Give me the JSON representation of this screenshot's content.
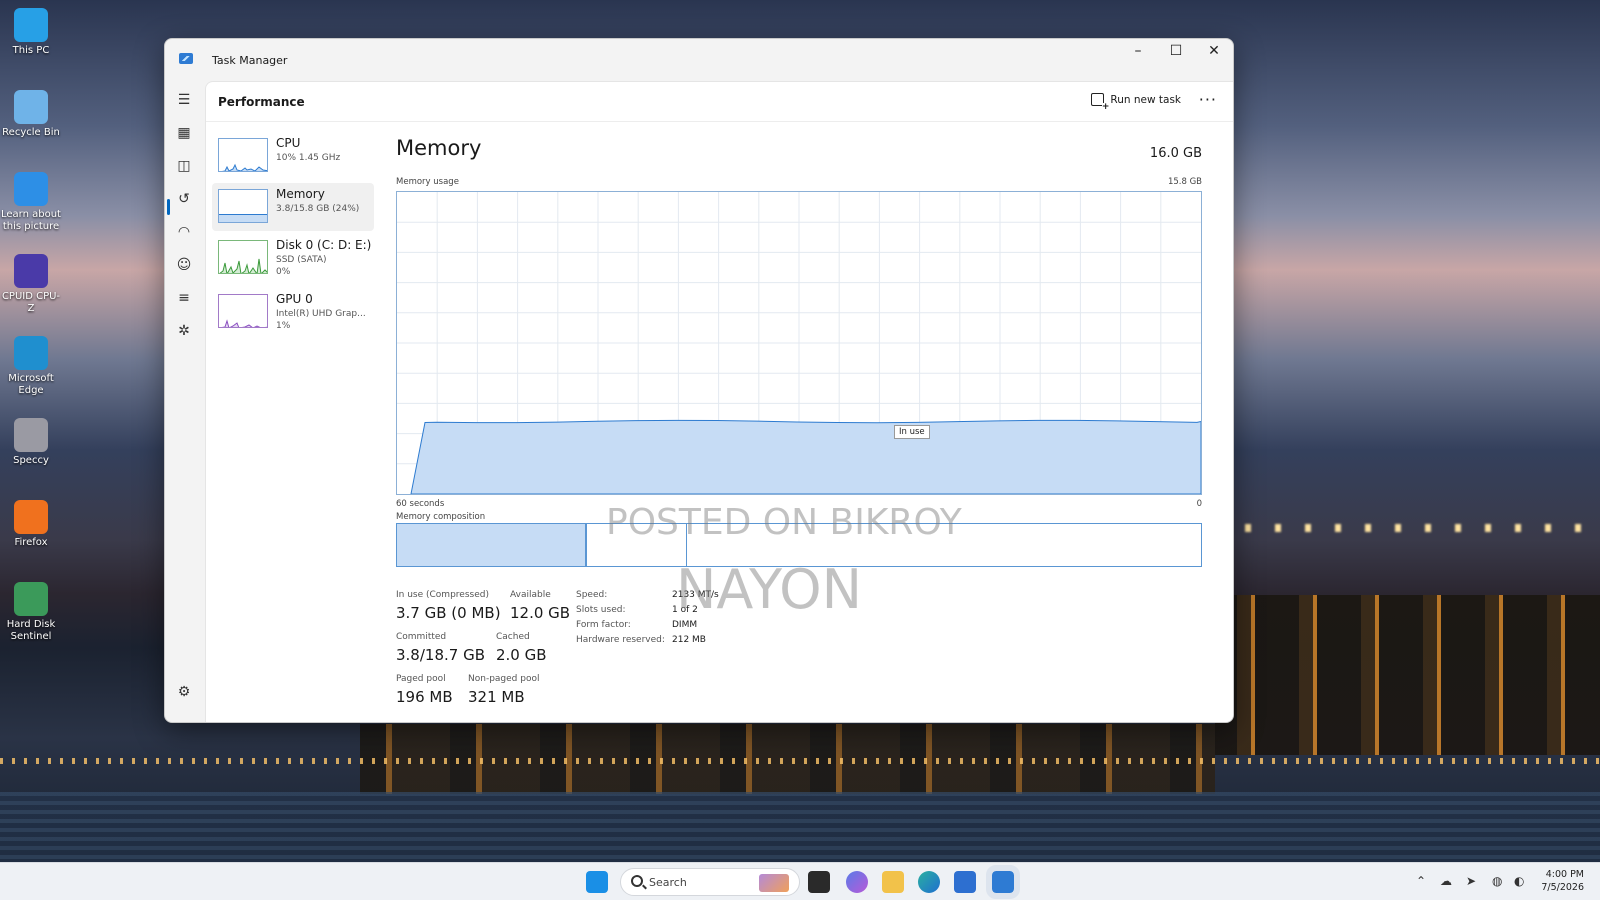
{
  "desktop": {
    "icons": [
      {
        "label": "This PC",
        "color": "#27a0e6"
      },
      {
        "label": "Recycle Bin",
        "color": "#6fb3e8"
      },
      {
        "label": "Learn about this picture",
        "color": "#2d8fe6"
      },
      {
        "label": "CPUID CPU-Z",
        "color": "#4a3aa8"
      },
      {
        "label": "Microsoft Edge",
        "color": "#1f8fcf"
      },
      {
        "label": "Speccy",
        "color": "#9a9aa3"
      },
      {
        "label": "Firefox",
        "color": "#f0711e"
      },
      {
        "label": "Hard Disk Sentinel",
        "color": "#3b9a5a"
      }
    ]
  },
  "window": {
    "title": "Task Manager",
    "controls": {
      "minimize": "–",
      "maximize": "☐",
      "close": "✕"
    }
  },
  "header": {
    "page_title": "Performance",
    "run_new_task": "Run new task",
    "more": "···"
  },
  "perf_list": [
    {
      "name": "CPU",
      "sub1": "10% 1.45 GHz",
      "sub2": ""
    },
    {
      "name": "Memory",
      "sub1": "3.8/15.8 GB (24%)",
      "sub2": ""
    },
    {
      "name": "Disk 0 (C: D: E:)",
      "sub1": "SSD (SATA)",
      "sub2": "0%"
    },
    {
      "name": "GPU 0",
      "sub1": "Intel(R) UHD Grap...",
      "sub2": "1%"
    }
  ],
  "memory": {
    "title": "Memory",
    "total": "16.0 GB",
    "usage_label": "Memory usage",
    "usage_max": "15.8 GB",
    "x_left": "60 seconds",
    "x_right": "0",
    "tooltip": "In use",
    "composition_label": "Memory composition",
    "in_use_fraction": 0.24
  },
  "stats": {
    "in_use_label": "In use (Compressed)",
    "in_use_value": "3.7 GB (0 MB)",
    "available_label": "Available",
    "available_value": "12.0 GB",
    "committed_label": "Committed",
    "committed_value": "3.8/18.7 GB",
    "cached_label": "Cached",
    "cached_value": "2.0 GB",
    "paged_label": "Paged pool",
    "paged_value": "196 MB",
    "nonpaged_label": "Non-paged pool",
    "nonpaged_value": "321 MB"
  },
  "specs": {
    "speed_label": "Speed:",
    "speed_value": "2133 MT/s",
    "slots_label": "Slots used:",
    "slots_value": "1 of 2",
    "form_label": "Form factor:",
    "form_value": "DIMM",
    "hw_label": "Hardware reserved:",
    "hw_value": "212 MB"
  },
  "watermark": {
    "line1": "POSTED ON BIKROY",
    "line2": "NAYON"
  },
  "taskbar": {
    "search_placeholder": "Search",
    "time": "4:00 PM",
    "date": "7/5/2026",
    "accent": "#0067c0"
  }
}
